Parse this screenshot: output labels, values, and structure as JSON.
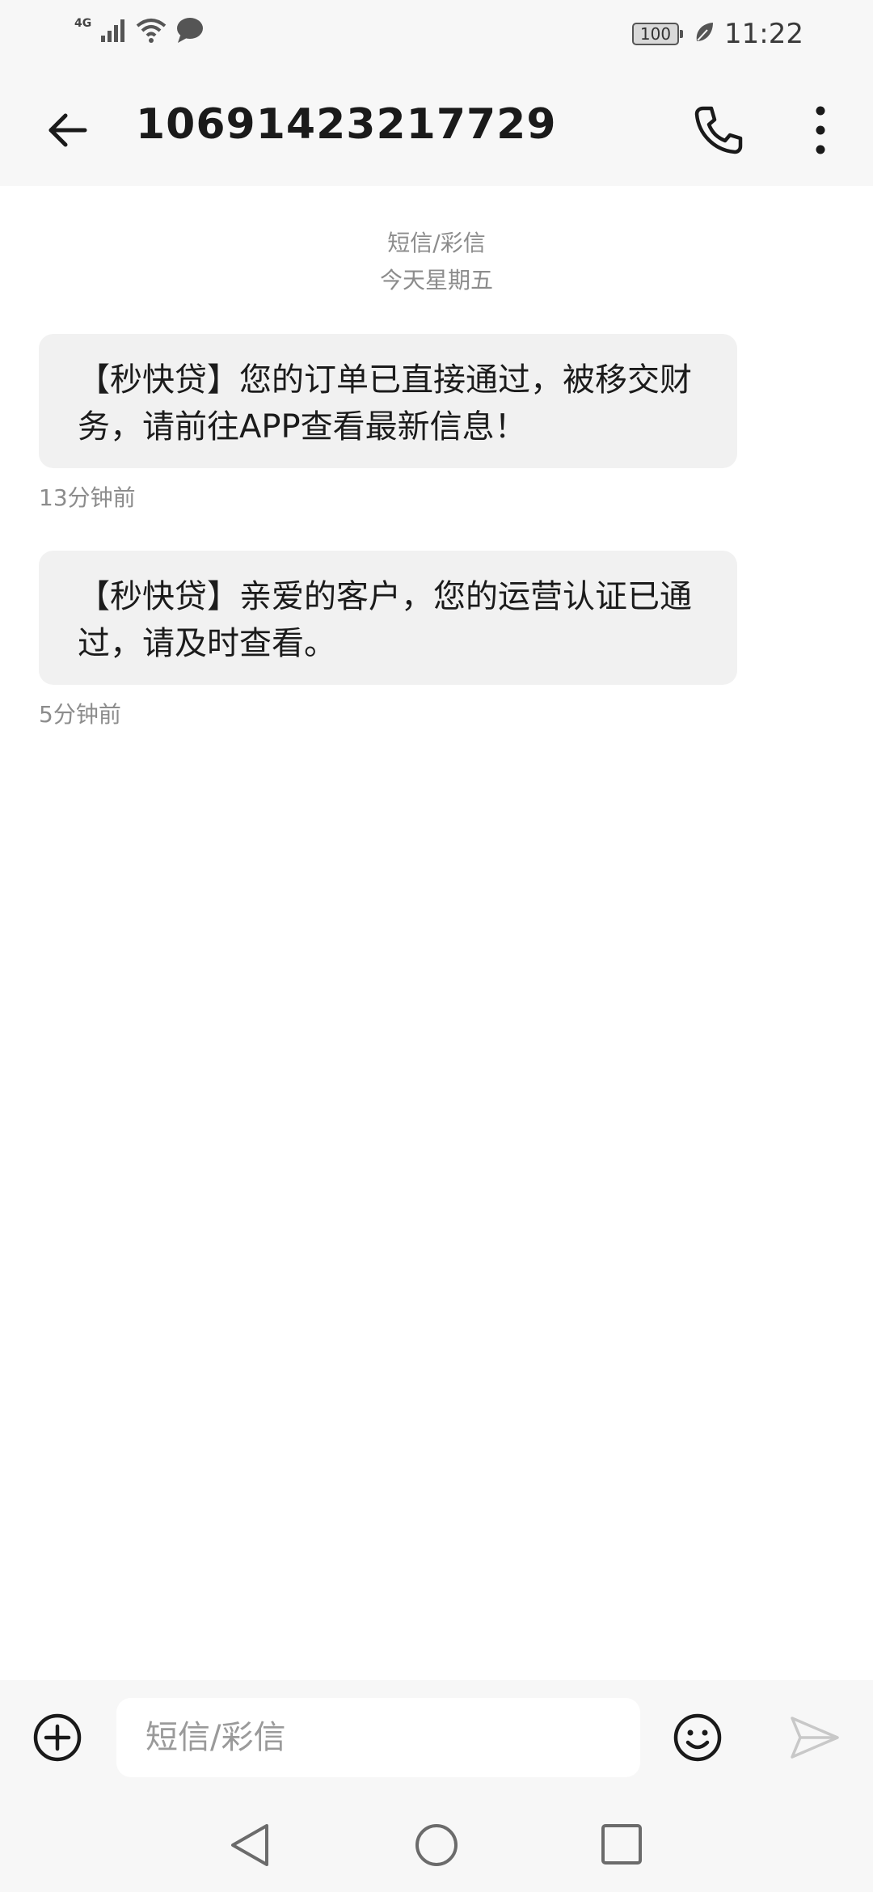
{
  "status_bar": {
    "network_label": "4G",
    "battery_level": "100",
    "time": "11:22",
    "icons": [
      "signal-icon",
      "wifi-icon",
      "chat-notification-icon",
      "battery-icon",
      "leaf-icon"
    ]
  },
  "header": {
    "back_icon": "arrow-left-icon",
    "title": "10691423217729",
    "call_icon": "phone-icon",
    "more_icon": "more-vertical-icon"
  },
  "conversation": {
    "type_label": "短信/彩信",
    "date_label": "今天星期五",
    "messages": [
      {
        "text": "【秒快贷】您的订单已直接通过，被移交财务，请前往APP查看最新信息！",
        "time": "13分钟前"
      },
      {
        "text": "【秒快贷】亲爱的客户，您的运营认证已通过，请及时查看。",
        "time": "5分钟前"
      }
    ]
  },
  "compose": {
    "add_icon": "plus-circle-icon",
    "input_value": "",
    "input_placeholder": "短信/彩信",
    "emoji_icon": "smiley-icon",
    "send_icon": "send-icon"
  },
  "navigation": {
    "icons": [
      "nav-back-icon",
      "nav-home-icon",
      "nav-recent-icon"
    ]
  },
  "colors": {
    "bar_background": "#f7f7f7",
    "bubble_background": "#f1f1f1",
    "secondary_text": "#8c8c8c",
    "primary_text": "#1b1b1b"
  }
}
